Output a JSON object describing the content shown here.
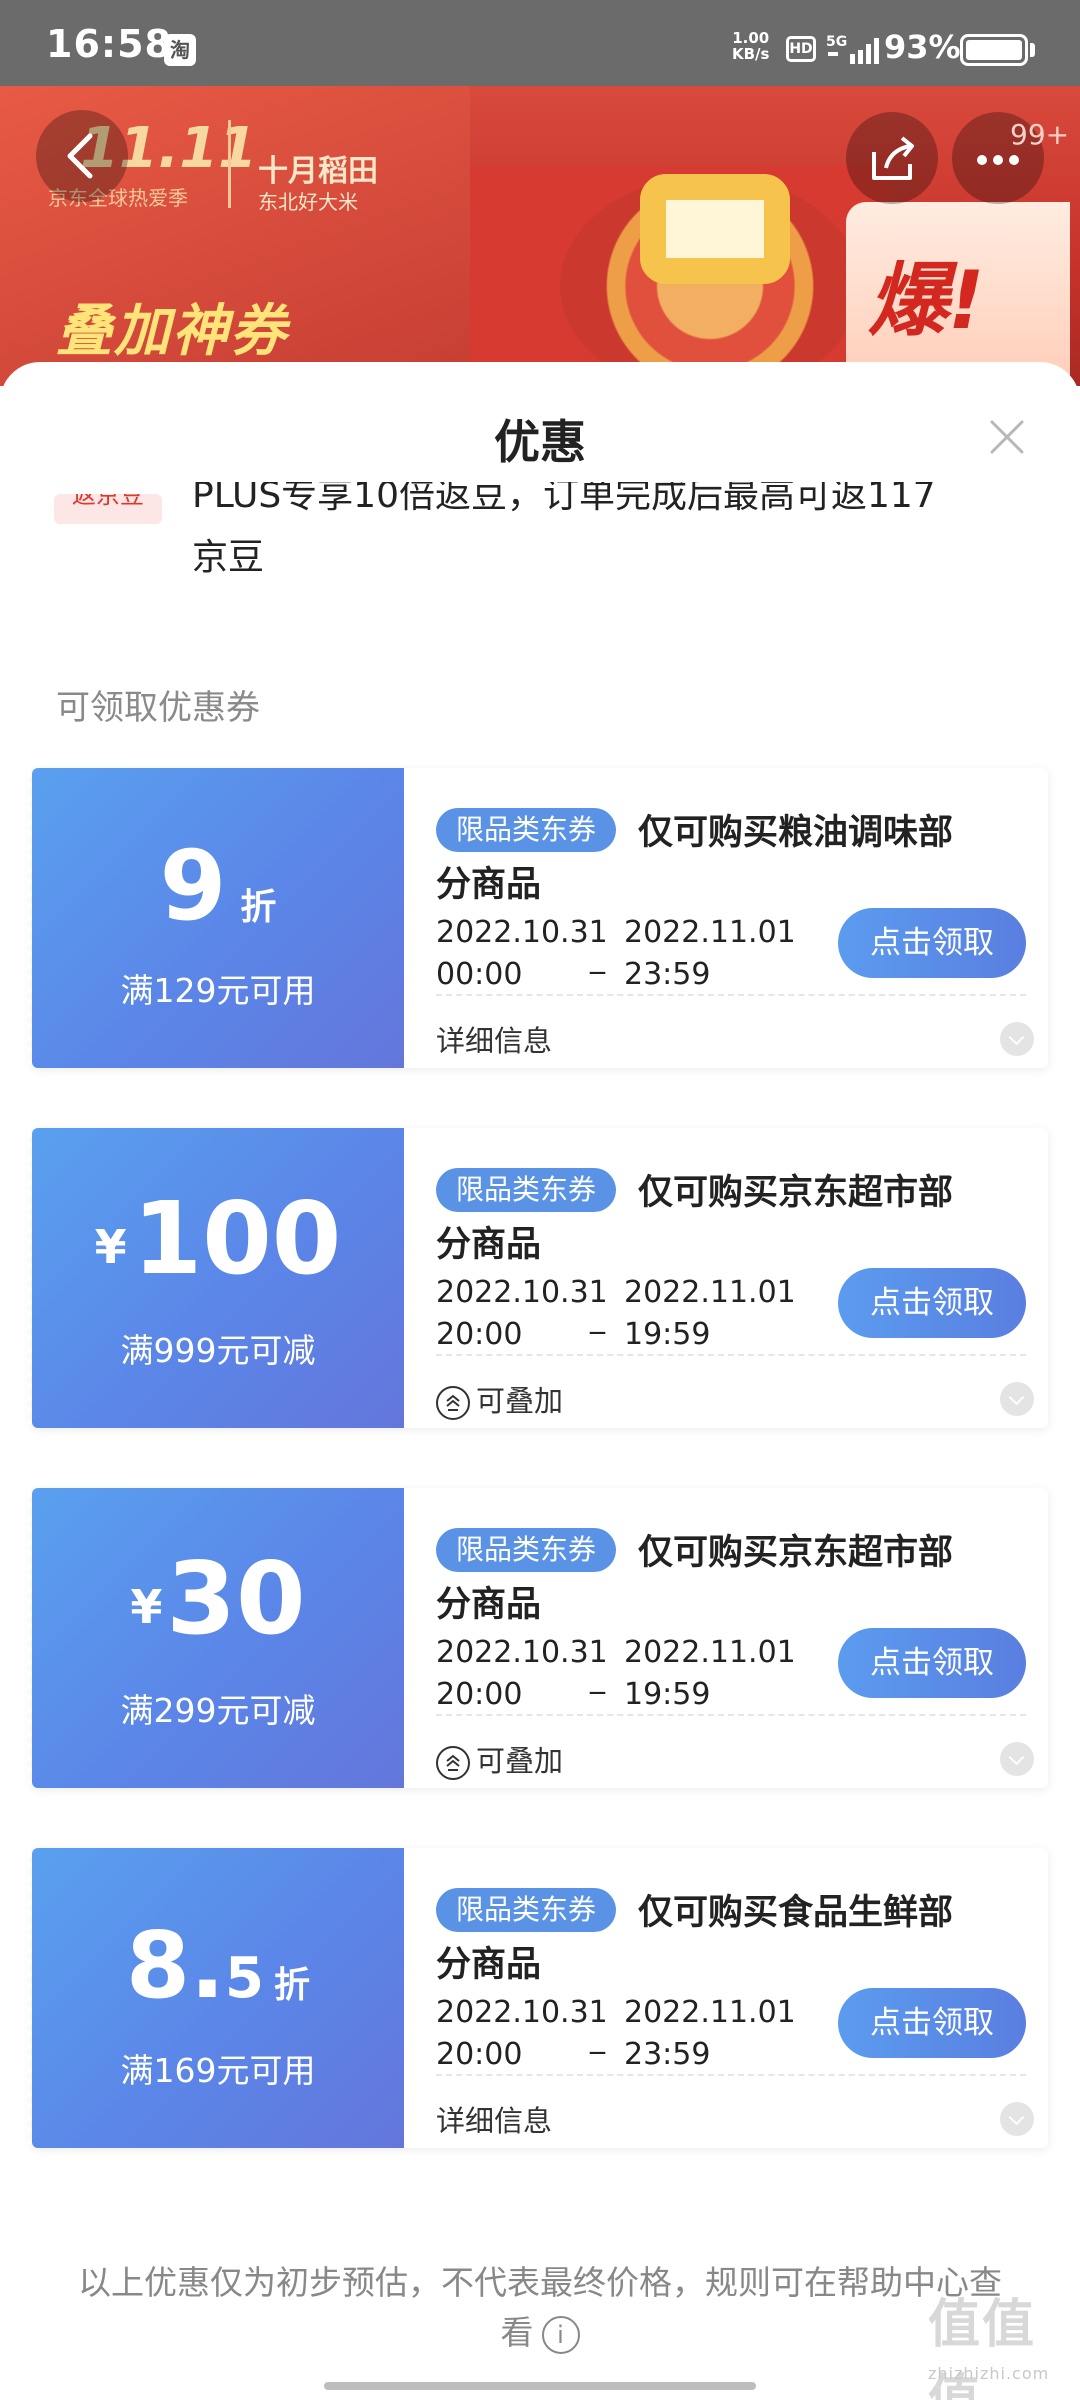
{
  "status_bar": {
    "time": "16:58",
    "app_badge": "淘",
    "net_speed_top": "1.00",
    "net_speed_bottom": "KB/s",
    "hd": "HD",
    "battery": "93%"
  },
  "banner": {
    "brand": "11.11",
    "brand_sub": "京东全球热爱季",
    "brand2": "十月稻田",
    "brand2_sub": "东北好大米",
    "slogan": "叠加神券",
    "tag": "爆!",
    "more_badge": "99+"
  },
  "sheet": {
    "title": "优惠",
    "peek_tag": "返京豆",
    "peek_line1": "PLUS专享10倍返豆，订单完成后最高可返117",
    "peek_line2": "京豆",
    "section_title": "可领取优惠券"
  },
  "coupons": [
    {
      "value_main": "9",
      "value_prefix": "",
      "value_suffix": "折",
      "condition": "满129元可用",
      "tag": "限品类东券",
      "title_line1": "仅可购买粮油调味部",
      "title_line2": "分商品",
      "start_date": "2022.10.31",
      "start_time": "00:00",
      "end_date": "2022.11.01",
      "end_time": "23:59",
      "button": "点击领取",
      "footer": "详细信息",
      "stackable": false
    },
    {
      "value_main": "100",
      "value_prefix": "¥",
      "value_suffix": "",
      "condition": "满999元可减",
      "tag": "限品类东券",
      "title_line1": "仅可购买京东超市部",
      "title_line2": "分商品",
      "start_date": "2022.10.31",
      "start_time": "20:00",
      "end_date": "2022.11.01",
      "end_time": "19:59",
      "button": "点击领取",
      "footer": "可叠加",
      "stackable": true
    },
    {
      "value_main": "30",
      "value_prefix": "¥",
      "value_suffix": "",
      "condition": "满299元可减",
      "tag": "限品类东券",
      "title_line1": "仅可购买京东超市部",
      "title_line2": "分商品",
      "start_date": "2022.10.31",
      "start_time": "20:00",
      "end_date": "2022.11.01",
      "end_time": "19:59",
      "button": "点击领取",
      "footer": "可叠加",
      "stackable": true
    },
    {
      "value_main": "8.",
      "value_minor": "5",
      "value_prefix": "",
      "value_suffix": "折",
      "condition": "满169元可用",
      "tag": "限品类东券",
      "title_line1": "仅可购买食品生鲜部",
      "title_line2": "分商品",
      "start_date": "2022.10.31",
      "start_time": "20:00",
      "end_date": "2022.11.01",
      "end_time": "23:59",
      "button": "点击领取",
      "footer": "详细信息",
      "stackable": false
    }
  ],
  "disclaimer": {
    "text": "以上优惠仅为初步预估，不代表最终价格，规则可在帮助中心查看",
    "info_icon": "i"
  },
  "watermark": {
    "text": "值值值",
    "sub": "zhizhizhi.com"
  },
  "colors": {
    "coupon_gradient_start": "#5aa0ef",
    "coupon_gradient_end": "#6476dc",
    "tag_bg": "#5a93e5",
    "banner_red": "#c7322b"
  }
}
